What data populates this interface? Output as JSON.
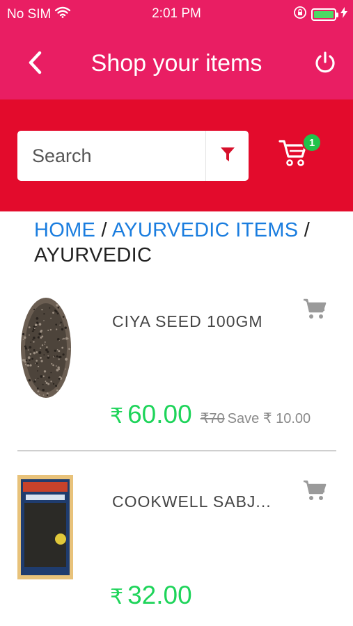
{
  "status": {
    "carrier": "No SIM",
    "time": "2:01 PM",
    "battery_level": 1.0,
    "battery_color": "#4cd964"
  },
  "header": {
    "title": "Shop your items",
    "back_icon": "chevron-left-icon",
    "power_icon": "power-icon",
    "color": "#e91e63"
  },
  "search": {
    "placeholder": "Search",
    "filter_icon": "filter-icon",
    "cart_count": "1",
    "band_color": "#e30b2c"
  },
  "breadcrumb": {
    "home": "HOME",
    "sep1": " / ",
    "category": "AYURVEDIC ITEMS",
    "sep2": " /",
    "current": "AYURVEDIC"
  },
  "products": [
    {
      "name": "CIYA SEED 100GM",
      "currency": "₹",
      "price": "60.00",
      "old_price": "₹70",
      "save": "Save ₹ 10.00"
    },
    {
      "name": "COOKWELL SABJ...",
      "currency": "₹",
      "price": "32.00",
      "old_price": "",
      "save": ""
    }
  ],
  "accent_green": "#1ed45a"
}
